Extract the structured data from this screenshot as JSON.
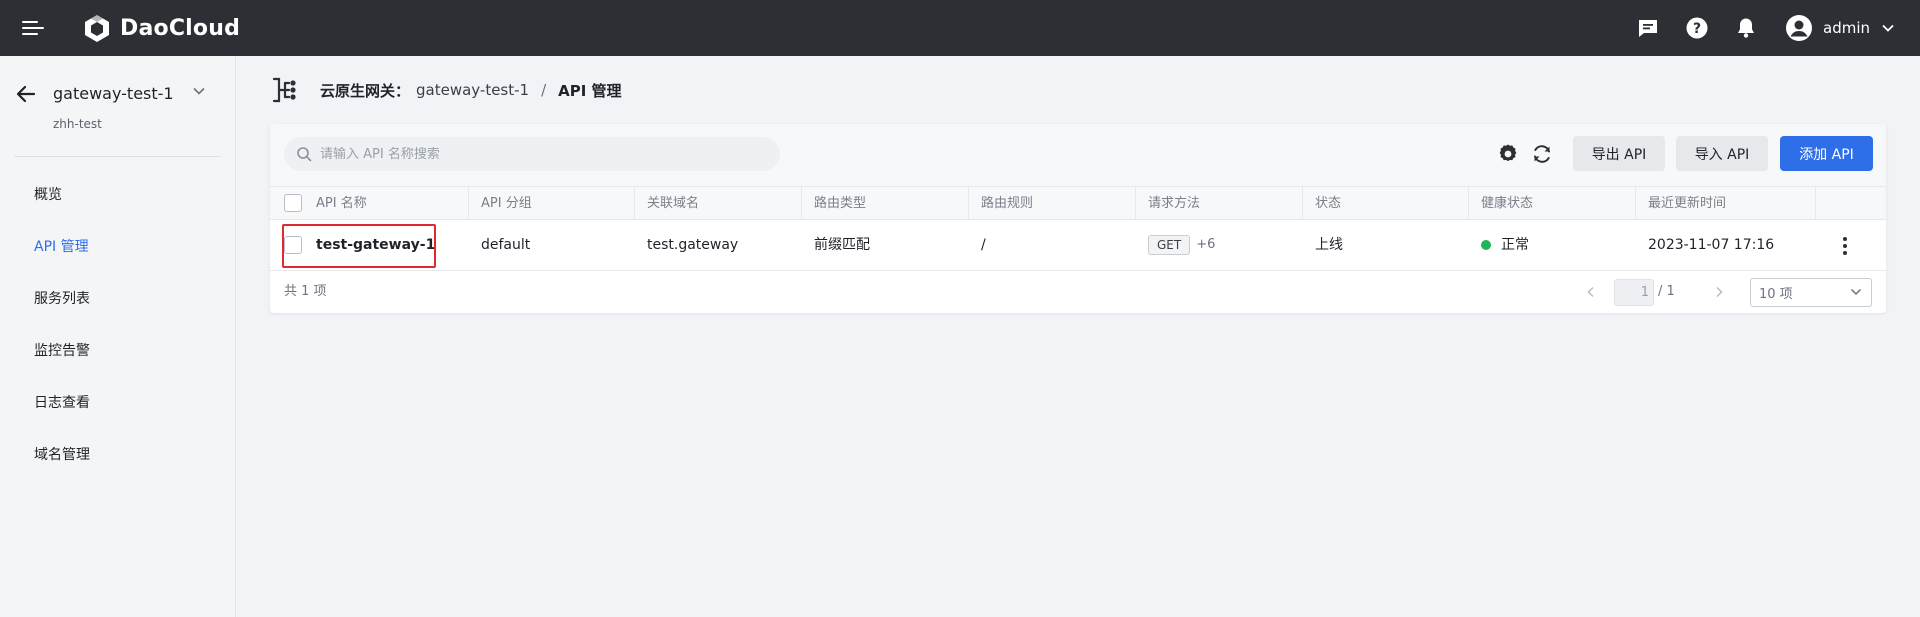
{
  "topbar": {
    "brand": "DaoCloud",
    "icons": [
      "menu-icon",
      "message-icon",
      "help-icon",
      "bell-icon",
      "user-avatar-icon",
      "chevron-down-icon"
    ],
    "user": "admin"
  },
  "sidebar": {
    "gateway_name": "gateway-test-1",
    "namespace": "zhh-test",
    "items": [
      {
        "label": "概览"
      },
      {
        "label": "API 管理"
      },
      {
        "label": "服务列表"
      },
      {
        "label": "监控告警"
      },
      {
        "label": "日志查看"
      },
      {
        "label": "域名管理"
      }
    ],
    "active_index": 1
  },
  "breadcrumb": {
    "parent": "云原生网关：",
    "gateway": "gateway-test-1",
    "separator": "/",
    "current": "API 管理"
  },
  "toolbar": {
    "search_placeholder": "请输入 API 名称搜索",
    "export_label": "导出 API",
    "import_label": "导入 API",
    "add_label": "添加 API"
  },
  "table": {
    "columns": [
      "API 名称",
      "API 分组",
      "关联域名",
      "路由类型",
      "路由规则",
      "请求方法",
      "状态",
      "健康状态",
      "最近更新时间"
    ],
    "rows": [
      {
        "name": "test-gateway-1",
        "group": "default",
        "domain": "test.gateway",
        "route_type": "前缀匹配",
        "route_rule": "/",
        "method": "GET",
        "method_more": "+6",
        "status": "上线",
        "health": "正常",
        "updated": "2023-11-07 17:16"
      }
    ]
  },
  "footer": {
    "total": "共 1 项",
    "current_page": "1",
    "total_pages": "/ 1",
    "page_size": "10 项"
  },
  "colors": {
    "accent": "#2e6ee8",
    "topbar": "#2c2f33",
    "health_ok": "#22b457",
    "highlight": "#e0282e"
  }
}
